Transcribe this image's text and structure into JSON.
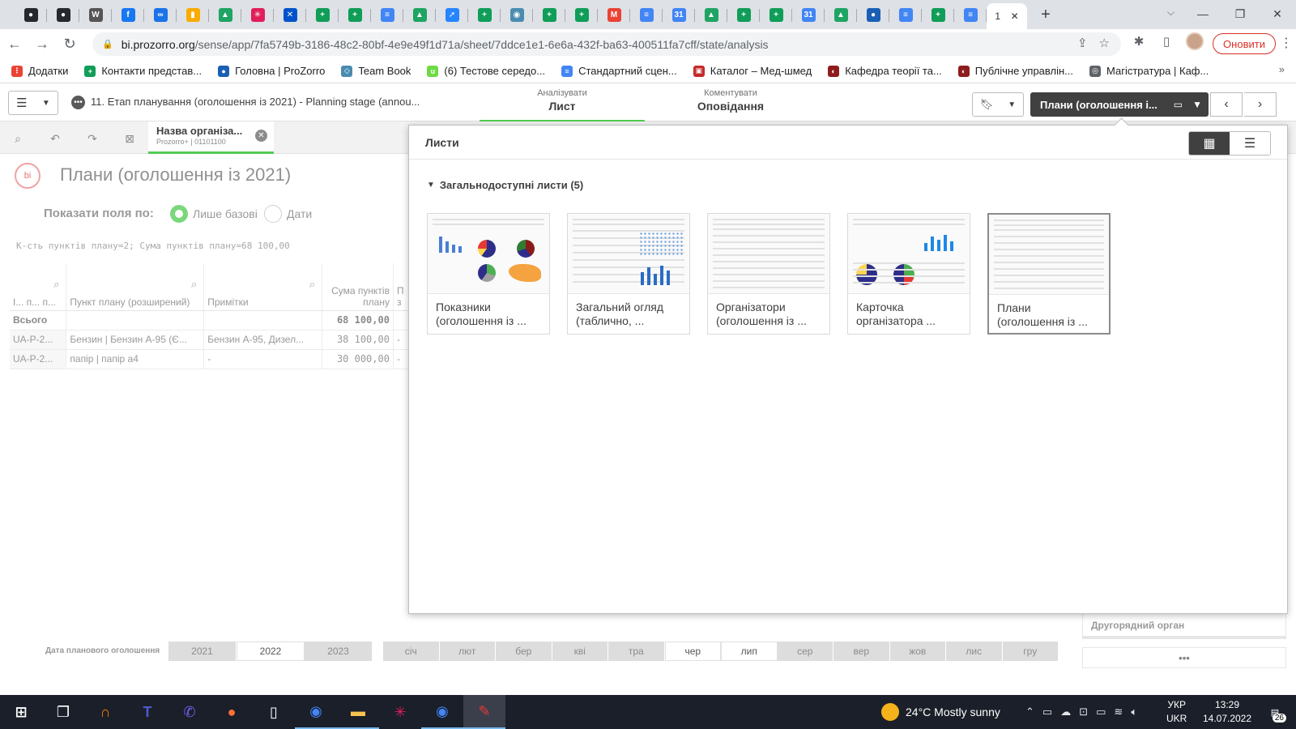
{
  "browser": {
    "tab_favicons": [
      {
        "icon": "github-icon",
        "color": "#24292e"
      },
      {
        "icon": "github-icon",
        "color": "#24292e"
      },
      {
        "icon": "wikipedia-icon",
        "color": "#555555"
      },
      {
        "icon": "facebook-icon",
        "color": "#1877f2"
      },
      {
        "icon": "link-icon",
        "color": "#1a73e8"
      },
      {
        "icon": "analytics-icon",
        "color": "#f9ab00"
      },
      {
        "icon": "drive-icon",
        "color": "#1fa463"
      },
      {
        "icon": "slack-icon",
        "color": "#e01e5a"
      },
      {
        "icon": "confluence-icon",
        "color": "#0052cc"
      },
      {
        "icon": "sheets-icon",
        "color": "#0f9d58"
      },
      {
        "icon": "sheets-icon",
        "color": "#0f9d58"
      },
      {
        "icon": "docs-icon",
        "color": "#4285f4"
      },
      {
        "icon": "drive-icon",
        "color": "#1fa463"
      },
      {
        "icon": "jira-icon",
        "color": "#2684ff"
      },
      {
        "icon": "sheets-icon",
        "color": "#0f9d58"
      },
      {
        "icon": "eye-icon",
        "color": "#4a8cb0"
      },
      {
        "icon": "sheets-icon",
        "color": "#0f9d58"
      },
      {
        "icon": "sheets-icon",
        "color": "#0f9d58"
      },
      {
        "icon": "gmail-icon",
        "color": "#ea4335"
      },
      {
        "icon": "docs-icon",
        "color": "#4285f4"
      },
      {
        "icon": "calendar-icon",
        "color": "#4285f4"
      },
      {
        "icon": "drive-icon",
        "color": "#1fa463"
      },
      {
        "icon": "sheets-icon",
        "color": "#0f9d58"
      },
      {
        "icon": "sheets-icon",
        "color": "#0f9d58"
      },
      {
        "icon": "calendar-icon",
        "color": "#4285f4"
      },
      {
        "icon": "drive-icon",
        "color": "#1fa463"
      },
      {
        "icon": "prozorro-icon",
        "color": "#1a5fb4"
      },
      {
        "icon": "docs-icon",
        "color": "#4285f4"
      },
      {
        "icon": "sheets-icon",
        "color": "#0f9d58"
      },
      {
        "icon": "docs-icon",
        "color": "#4285f4"
      }
    ],
    "active_tab_label": "1",
    "active_tab_close": "✕",
    "new_tab": "+",
    "url_host": "bi.prozorro.org",
    "url_path": "/sense/app/7fa5749b-3186-48c2-80bf-4e9e49f1d71a/sheet/7ddce1e1-6e6a-432f-ba63-400511fa7cff/state/analysis",
    "update_button": "Оновити",
    "bookmarks": [
      {
        "label": "Додатки",
        "icon": "apps-icon",
        "color": "#ea4335"
      },
      {
        "label": "Контакти представ...",
        "icon": "sheets-icon",
        "color": "#0f9d58"
      },
      {
        "label": "Головна | ProZorro",
        "icon": "prozorro-icon",
        "color": "#1a5fb4"
      },
      {
        "label": "Team Book",
        "icon": "teambook-icon",
        "color": "#4a8cb0"
      },
      {
        "label": "(6) Тестове середо...",
        "icon": "upwork-icon",
        "color": "#6fda44"
      },
      {
        "label": "Стандартний сцен...",
        "icon": "docs-icon",
        "color": "#4285f4"
      },
      {
        "label": "Каталог – Мед-шмед",
        "icon": "catalog-icon",
        "color": "#c62828"
      },
      {
        "label": "Кафедра теорії та...",
        "icon": "university-icon",
        "color": "#8e1c1c"
      },
      {
        "label": "Публічне управлін...",
        "icon": "university-icon",
        "color": "#8e1c1c"
      },
      {
        "label": "Магістратура | Каф...",
        "icon": "globe-icon",
        "color": "#5f6368"
      }
    ],
    "bookmarks_more": "»"
  },
  "qlik": {
    "app_title": "11. Етап планування (оголошення із 2021) - Planning stage (annou...",
    "mode_analyze_sub": "Аналізувати",
    "mode_analyze_main": "Лист",
    "mode_narrate_sub": "Коментувати",
    "mode_narrate_main": "Оповідання",
    "current_sheet_button": "Плани (оголошення і...",
    "selection_chip": {
      "title": "Назва організа...",
      "subtitle": "Prozorro+ | 01101100"
    }
  },
  "sheet": {
    "logo": "bi",
    "title": "Плани (оголошення із 2021)",
    "show_fields_label": "Показати поля по:",
    "radio_options": [
      {
        "label": "Лише базові",
        "selected": true
      },
      {
        "label": "Дати",
        "selected": false
      }
    ],
    "kpi_line": "К-сть пунктів плану=2; Сума пунктів плану=68 100,00",
    "table": {
      "headers": [
        "І... п... п...",
        "Пункт плану (розширений)",
        "Примітки",
        "Сума пунктів плану",
        "П з"
      ],
      "total_row": [
        "Всього",
        "",
        "",
        "68 100,00",
        ""
      ],
      "rows": [
        [
          "UA-P-2...",
          "Бензин | Бензин А-95 (Є...",
          "Бензин А-95, Дизел...",
          "38 100,00",
          "-"
        ],
        [
          "UA-P-2...",
          "папір | папір а4",
          "-",
          "30 000,00",
          "-"
        ]
      ]
    },
    "date_filter_label": "Дата планового оголошення",
    "years": [
      {
        "label": "2021",
        "selected": false
      },
      {
        "label": "2022",
        "selected": true
      },
      {
        "label": "2023",
        "selected": false
      }
    ],
    "months": [
      {
        "label": "січ",
        "selected": false
      },
      {
        "label": "лют",
        "selected": false
      },
      {
        "label": "бер",
        "selected": false
      },
      {
        "label": "кві",
        "selected": false
      },
      {
        "label": "тра",
        "selected": false
      },
      {
        "label": "чер",
        "selected": true
      },
      {
        "label": "лип",
        "selected": true
      },
      {
        "label": "сер",
        "selected": false
      },
      {
        "label": "вер",
        "selected": false
      },
      {
        "label": "жов",
        "selected": false
      },
      {
        "label": "лис",
        "selected": false
      },
      {
        "label": "гру",
        "selected": false
      }
    ],
    "side_filter_label": "Другорядний орган",
    "side_more": "•••"
  },
  "sheets_popover": {
    "header": "Листи",
    "section_title": "Загальнодоступні листи (5)",
    "cards": [
      {
        "title": "Показники (оголошення із ...",
        "thumb": "dashboard-pies",
        "current": false
      },
      {
        "title": "Загальний огляд (таблично, ...",
        "thumb": "table-scatter",
        "current": false
      },
      {
        "title": "Організатори (оголошення із ...",
        "thumb": "table",
        "current": false
      },
      {
        "title": "Карточка організатора ...",
        "thumb": "organizer-card",
        "current": false
      },
      {
        "title": "Плани (оголошення із ...",
        "thumb": "table",
        "current": true
      }
    ]
  },
  "taskbar": {
    "apps": [
      {
        "icon": "windows-start-icon",
        "color": "#ffffff",
        "running": false
      },
      {
        "icon": "task-view-icon",
        "color": "#ffffff",
        "running": false
      },
      {
        "icon": "headphones-icon",
        "color": "#f57c00",
        "running": false
      },
      {
        "icon": "teams-icon",
        "color": "#5059c9",
        "running": false
      },
      {
        "icon": "viber-icon",
        "color": "#7360f2",
        "running": false
      },
      {
        "icon": "firefox-icon",
        "color": "#ff7139",
        "running": false
      },
      {
        "icon": "file-icon",
        "color": "#ffffff",
        "running": false
      },
      {
        "icon": "chrome-icon",
        "color": "#4285f4",
        "running": true
      },
      {
        "icon": "explorer-icon",
        "color": "#f8c44f",
        "running": true
      },
      {
        "icon": "slack-icon",
        "color": "#e01e5a",
        "running": false
      },
      {
        "icon": "chrome-icon",
        "color": "#4285f4",
        "running": true
      },
      {
        "icon": "pen-app-icon",
        "color": "#e53935",
        "active": true
      }
    ],
    "weather": "24°C  Mostly sunny",
    "lang_top": "УКР",
    "lang_bottom": "UKR",
    "time": "13:29",
    "date": "14.07.2022",
    "notifications": "26"
  }
}
